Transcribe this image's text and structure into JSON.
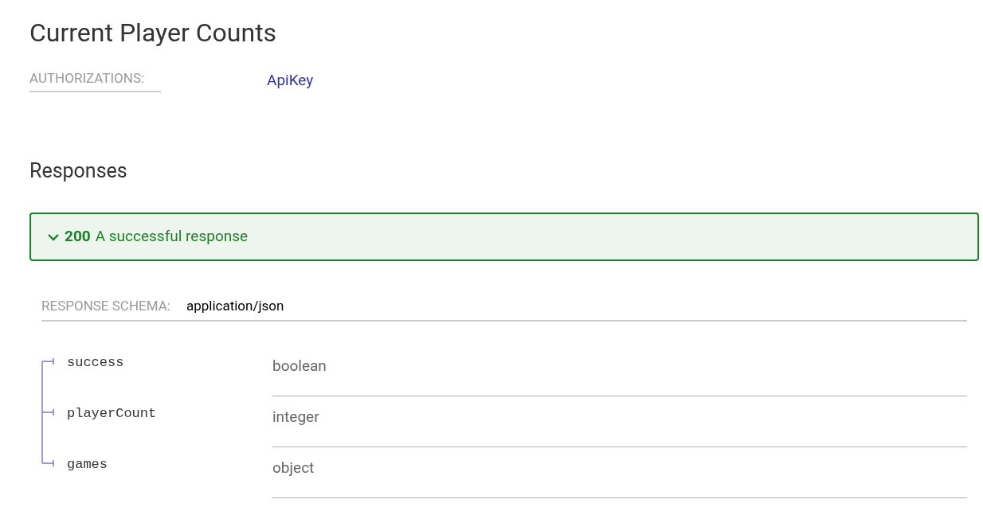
{
  "title": "Current Player Counts",
  "authorizations": {
    "label": "AUTHORIZATIONS:",
    "value": "ApiKey"
  },
  "responses": {
    "heading": "Responses",
    "items": [
      {
        "code": "200",
        "description": "A successful response",
        "expanded": true
      }
    ]
  },
  "response_schema": {
    "label": "RESPONSE SCHEMA:",
    "value": "application/json"
  },
  "fields": [
    {
      "name": "success",
      "type": "boolean"
    },
    {
      "name": "playerCount",
      "type": "integer"
    },
    {
      "name": "games",
      "type": "object"
    }
  ]
}
